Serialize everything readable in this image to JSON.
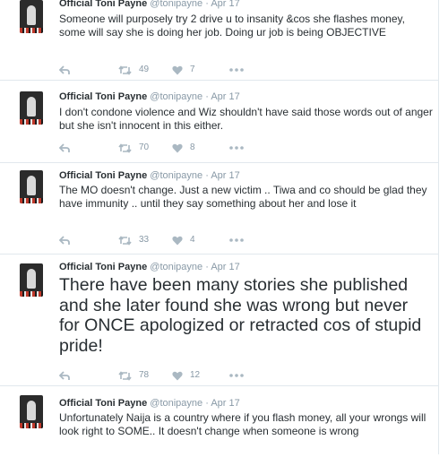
{
  "tweets": [
    {
      "name": "Official Toni Payne",
      "handle": "@tonipayne",
      "dot": "·",
      "date": "Apr 17",
      "text": "Someone will purposely try 2 drive u to insanity &cos she flashes money, some will say she is doing her job. Doing ur job is being OBJECTIVE",
      "retweets": "49",
      "likes": "7"
    },
    {
      "name": "Official Toni Payne",
      "handle": "@tonipayne",
      "dot": "·",
      "date": "Apr 17",
      "text": "I don't condone violence and Wiz shouldn't have said those words out of anger but she isn't innocent in this either.",
      "retweets": "70",
      "likes": "8"
    },
    {
      "name": "Official Toni Payne",
      "handle": "@tonipayne",
      "dot": "·",
      "date": "Apr 17",
      "text": "The MO doesn't change. Just a new victim .. Tiwa and co should be glad they have immunity .. until they say something about her and lose it",
      "retweets": "33",
      "likes": "4"
    },
    {
      "name": "Official Toni Payne",
      "handle": "@tonipayne",
      "dot": "·",
      "date": "Apr 17",
      "text": "There have been many stories she published and she later found she was wrong but never for ONCE apologized or retracted cos of stupid pride!",
      "retweets": "78",
      "likes": "12"
    },
    {
      "name": "Official Toni Payne",
      "handle": "@tonipayne",
      "dot": "·",
      "date": "Apr 17",
      "text": "Unfortunately Naija is a country where if you flash money, all your wrongs will look right to SOME.. It doesn't change when someone is wrong"
    }
  ],
  "icons": {
    "reply": "reply-icon",
    "retweet": "retweet-icon",
    "like": "heart-icon",
    "more": "more-icon"
  },
  "colors": {
    "icon": "#aab8c2",
    "muted": "#8899a6",
    "text": "#292f33",
    "border": "#e1e8ed"
  }
}
